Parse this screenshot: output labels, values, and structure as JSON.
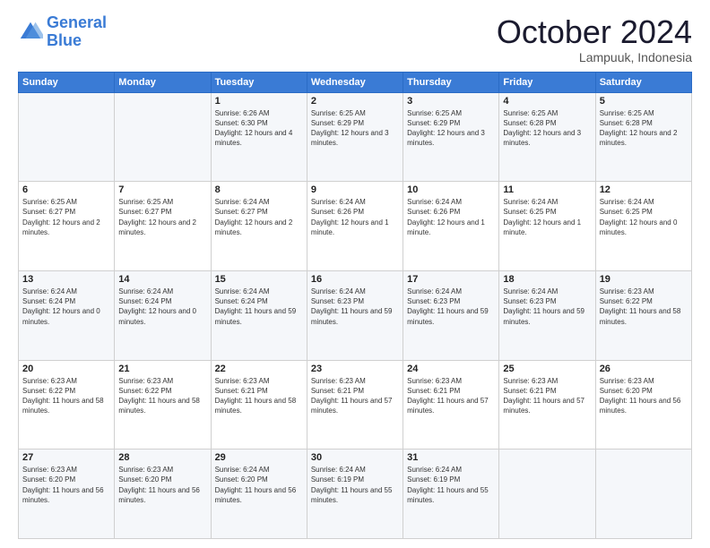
{
  "header": {
    "logo_line1": "General",
    "logo_line2": "Blue",
    "month": "October 2024",
    "location": "Lampuuk, Indonesia"
  },
  "weekdays": [
    "Sunday",
    "Monday",
    "Tuesday",
    "Wednesday",
    "Thursday",
    "Friday",
    "Saturday"
  ],
  "weeks": [
    [
      {
        "day": "",
        "info": ""
      },
      {
        "day": "",
        "info": ""
      },
      {
        "day": "1",
        "info": "Sunrise: 6:26 AM\nSunset: 6:30 PM\nDaylight: 12 hours and 4 minutes."
      },
      {
        "day": "2",
        "info": "Sunrise: 6:25 AM\nSunset: 6:29 PM\nDaylight: 12 hours and 3 minutes."
      },
      {
        "day": "3",
        "info": "Sunrise: 6:25 AM\nSunset: 6:29 PM\nDaylight: 12 hours and 3 minutes."
      },
      {
        "day": "4",
        "info": "Sunrise: 6:25 AM\nSunset: 6:28 PM\nDaylight: 12 hours and 3 minutes."
      },
      {
        "day": "5",
        "info": "Sunrise: 6:25 AM\nSunset: 6:28 PM\nDaylight: 12 hours and 2 minutes."
      }
    ],
    [
      {
        "day": "6",
        "info": "Sunrise: 6:25 AM\nSunset: 6:27 PM\nDaylight: 12 hours and 2 minutes."
      },
      {
        "day": "7",
        "info": "Sunrise: 6:25 AM\nSunset: 6:27 PM\nDaylight: 12 hours and 2 minutes."
      },
      {
        "day": "8",
        "info": "Sunrise: 6:24 AM\nSunset: 6:27 PM\nDaylight: 12 hours and 2 minutes."
      },
      {
        "day": "9",
        "info": "Sunrise: 6:24 AM\nSunset: 6:26 PM\nDaylight: 12 hours and 1 minute."
      },
      {
        "day": "10",
        "info": "Sunrise: 6:24 AM\nSunset: 6:26 PM\nDaylight: 12 hours and 1 minute."
      },
      {
        "day": "11",
        "info": "Sunrise: 6:24 AM\nSunset: 6:25 PM\nDaylight: 12 hours and 1 minute."
      },
      {
        "day": "12",
        "info": "Sunrise: 6:24 AM\nSunset: 6:25 PM\nDaylight: 12 hours and 0 minutes."
      }
    ],
    [
      {
        "day": "13",
        "info": "Sunrise: 6:24 AM\nSunset: 6:24 PM\nDaylight: 12 hours and 0 minutes."
      },
      {
        "day": "14",
        "info": "Sunrise: 6:24 AM\nSunset: 6:24 PM\nDaylight: 12 hours and 0 minutes."
      },
      {
        "day": "15",
        "info": "Sunrise: 6:24 AM\nSunset: 6:24 PM\nDaylight: 11 hours and 59 minutes."
      },
      {
        "day": "16",
        "info": "Sunrise: 6:24 AM\nSunset: 6:23 PM\nDaylight: 11 hours and 59 minutes."
      },
      {
        "day": "17",
        "info": "Sunrise: 6:24 AM\nSunset: 6:23 PM\nDaylight: 11 hours and 59 minutes."
      },
      {
        "day": "18",
        "info": "Sunrise: 6:24 AM\nSunset: 6:23 PM\nDaylight: 11 hours and 59 minutes."
      },
      {
        "day": "19",
        "info": "Sunrise: 6:23 AM\nSunset: 6:22 PM\nDaylight: 11 hours and 58 minutes."
      }
    ],
    [
      {
        "day": "20",
        "info": "Sunrise: 6:23 AM\nSunset: 6:22 PM\nDaylight: 11 hours and 58 minutes."
      },
      {
        "day": "21",
        "info": "Sunrise: 6:23 AM\nSunset: 6:22 PM\nDaylight: 11 hours and 58 minutes."
      },
      {
        "day": "22",
        "info": "Sunrise: 6:23 AM\nSunset: 6:21 PM\nDaylight: 11 hours and 58 minutes."
      },
      {
        "day": "23",
        "info": "Sunrise: 6:23 AM\nSunset: 6:21 PM\nDaylight: 11 hours and 57 minutes."
      },
      {
        "day": "24",
        "info": "Sunrise: 6:23 AM\nSunset: 6:21 PM\nDaylight: 11 hours and 57 minutes."
      },
      {
        "day": "25",
        "info": "Sunrise: 6:23 AM\nSunset: 6:21 PM\nDaylight: 11 hours and 57 minutes."
      },
      {
        "day": "26",
        "info": "Sunrise: 6:23 AM\nSunset: 6:20 PM\nDaylight: 11 hours and 56 minutes."
      }
    ],
    [
      {
        "day": "27",
        "info": "Sunrise: 6:23 AM\nSunset: 6:20 PM\nDaylight: 11 hours and 56 minutes."
      },
      {
        "day": "28",
        "info": "Sunrise: 6:23 AM\nSunset: 6:20 PM\nDaylight: 11 hours and 56 minutes."
      },
      {
        "day": "29",
        "info": "Sunrise: 6:24 AM\nSunset: 6:20 PM\nDaylight: 11 hours and 56 minutes."
      },
      {
        "day": "30",
        "info": "Sunrise: 6:24 AM\nSunset: 6:19 PM\nDaylight: 11 hours and 55 minutes."
      },
      {
        "day": "31",
        "info": "Sunrise: 6:24 AM\nSunset: 6:19 PM\nDaylight: 11 hours and 55 minutes."
      },
      {
        "day": "",
        "info": ""
      },
      {
        "day": "",
        "info": ""
      }
    ]
  ]
}
